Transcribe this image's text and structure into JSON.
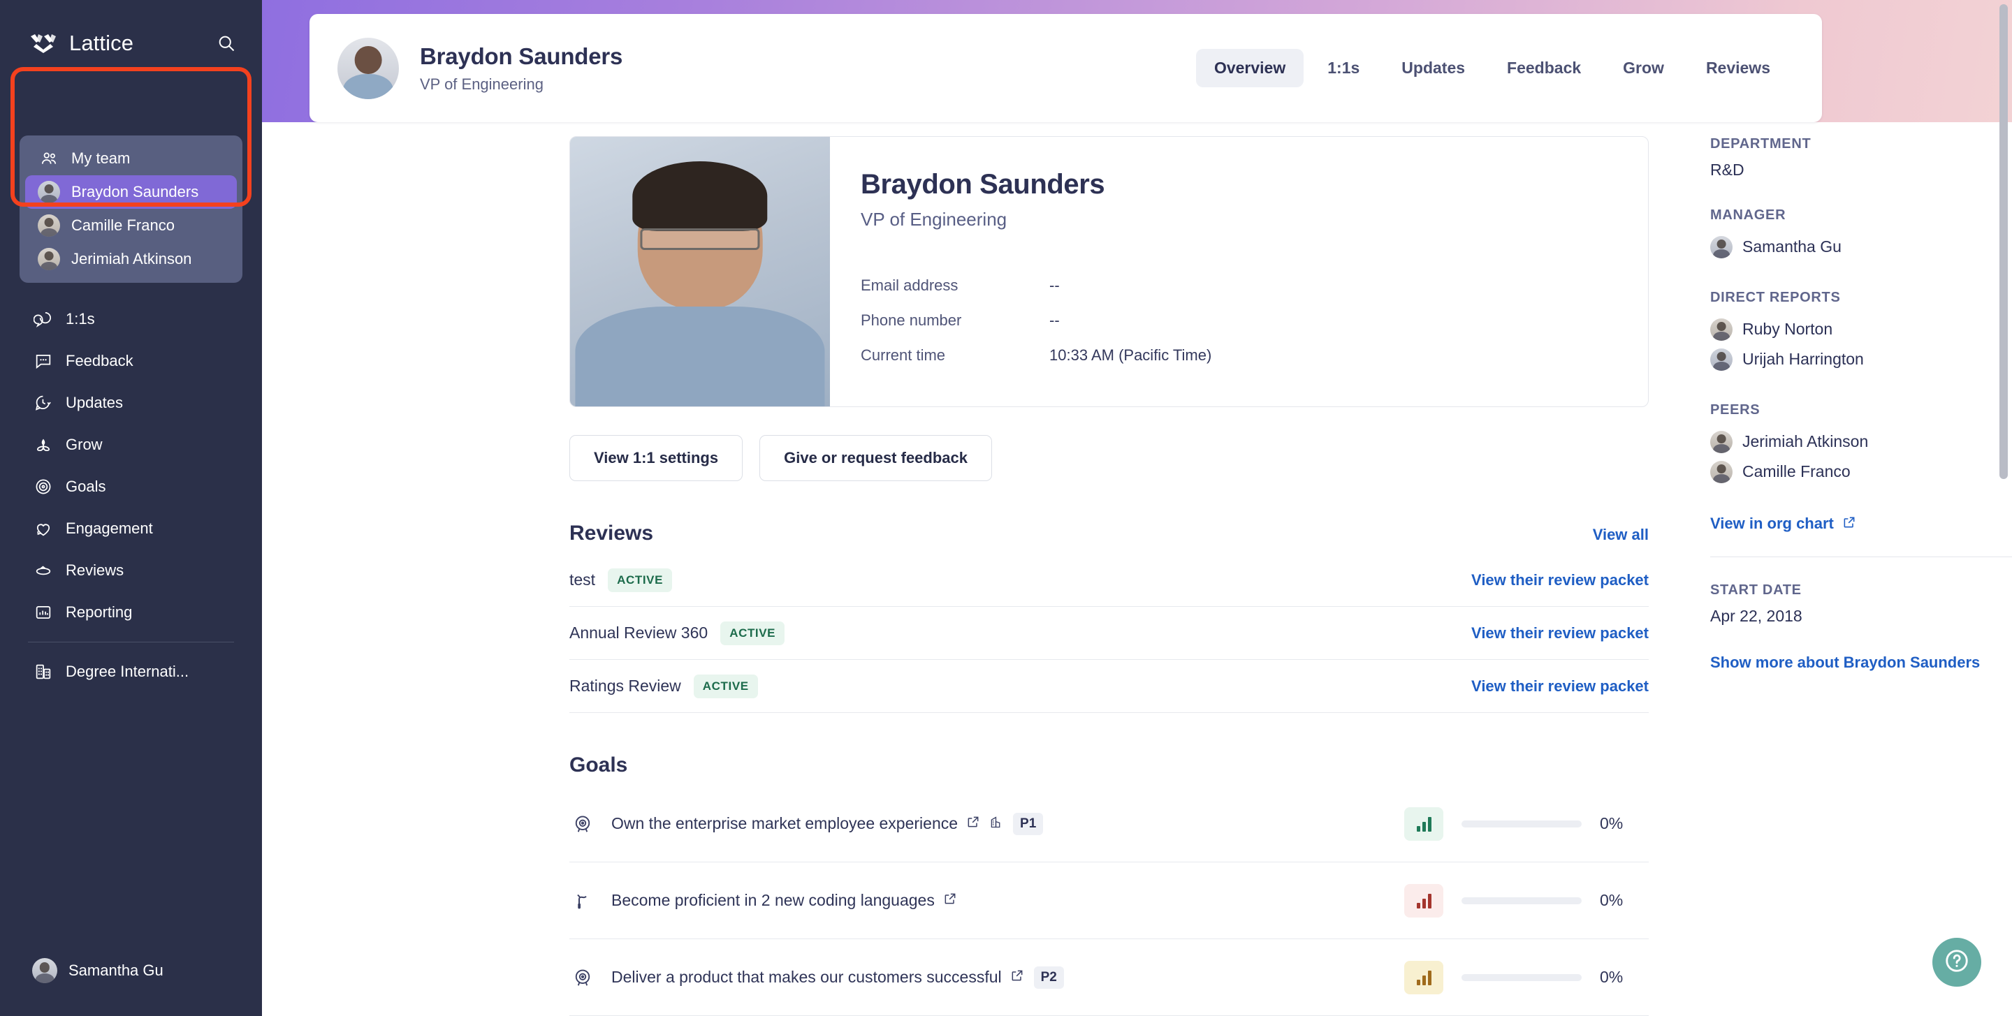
{
  "brand": {
    "name": "Lattice",
    "logo_icon": "lattice-logo-icon",
    "search_icon": "search-icon"
  },
  "sidebar": {
    "team_group": {
      "header_label": "My team",
      "header_icon": "people-icon",
      "members": [
        {
          "name": "Braydon Saunders",
          "active": true
        },
        {
          "name": "Camille Franco",
          "active": false
        },
        {
          "name": "Jerimiah Atkinson",
          "active": false
        }
      ]
    },
    "nav_items": [
      {
        "label": "1:1s",
        "icon": "chat-bubbles-icon"
      },
      {
        "label": "Feedback",
        "icon": "comment-dots-icon"
      },
      {
        "label": "Updates",
        "icon": "clock-bubble-icon"
      },
      {
        "label": "Grow",
        "icon": "sprout-icon"
      },
      {
        "label": "Goals",
        "icon": "target-icon"
      },
      {
        "label": "Engagement",
        "icon": "heart-arrow-icon"
      },
      {
        "label": "Reviews",
        "icon": "loop-arrow-icon"
      },
      {
        "label": "Reporting",
        "icon": "bar-chart-icon"
      }
    ],
    "company_item": {
      "label": "Degree Internati...",
      "icon": "buildings-icon"
    },
    "current_user": {
      "name": "Samantha Gu"
    }
  },
  "header": {
    "name": "Braydon Saunders",
    "role": "VP of Engineering",
    "tabs": [
      {
        "label": "Overview",
        "active": true
      },
      {
        "label": "1:1s",
        "active": false
      },
      {
        "label": "Updates",
        "active": false
      },
      {
        "label": "Feedback",
        "active": false
      },
      {
        "label": "Grow",
        "active": false
      },
      {
        "label": "Reviews",
        "active": false
      }
    ]
  },
  "profile": {
    "name": "Braydon Saunders",
    "role": "VP of Engineering",
    "fields": [
      {
        "label": "Email address",
        "value": "--"
      },
      {
        "label": "Phone number",
        "value": "--"
      },
      {
        "label": "Current time",
        "value": "10:33 AM (Pacific Time)"
      }
    ],
    "actions": [
      {
        "label": "View 1:1 settings"
      },
      {
        "label": "Give or request feedback"
      }
    ]
  },
  "reviews": {
    "title": "Reviews",
    "view_all_label": "View all",
    "items": [
      {
        "name": "test",
        "status": "ACTIVE",
        "link_label": "View their review packet"
      },
      {
        "name": "Annual Review 360",
        "status": "ACTIVE",
        "link_label": "View their review packet"
      },
      {
        "name": "Ratings Review",
        "status": "ACTIVE",
        "link_label": "View their review packet"
      }
    ]
  },
  "goals": {
    "title": "Goals",
    "items": [
      {
        "text": "Own the enterprise market employee experience",
        "icon": "target-icon",
        "has_external_link": true,
        "has_company_icon": true,
        "priority": "P1",
        "meter_color": "green",
        "progress": "0%"
      },
      {
        "text": "Become proficient in 2 new coding languages",
        "icon": "flag-icon",
        "has_external_link": true,
        "has_company_icon": false,
        "priority": "",
        "meter_color": "red",
        "progress": "0%"
      },
      {
        "text": "Deliver a product that makes our customers successful",
        "icon": "target-icon",
        "has_external_link": true,
        "has_company_icon": false,
        "priority": "P2",
        "meter_color": "amber",
        "progress": "0%"
      }
    ]
  },
  "details": {
    "department_label": "DEPARTMENT",
    "department_value": "R&D",
    "manager_label": "MANAGER",
    "manager_name": "Samantha Gu",
    "direct_reports_label": "DIRECT REPORTS",
    "direct_reports": [
      "Ruby Norton",
      "Urijah Harrington"
    ],
    "peers_label": "PEERS",
    "peers": [
      "Jerimiah Atkinson",
      "Camille Franco"
    ],
    "org_chart_link": "View in org chart",
    "start_date_label": "START DATE",
    "start_date_value": "Apr 22, 2018",
    "show_more_link": "Show more about Braydon Saunders"
  },
  "help": {
    "icon": "question-mark-icon"
  },
  "colors": {
    "sidebar_bg": "#2b3049",
    "active_person": "#8069d6",
    "highlight_outline": "#f4411e",
    "link_blue": "#1f5ec4",
    "badge_green_bg": "#e8f5ee",
    "badge_green_fg": "#1c6b4b",
    "help_fab": "#66ada4"
  }
}
